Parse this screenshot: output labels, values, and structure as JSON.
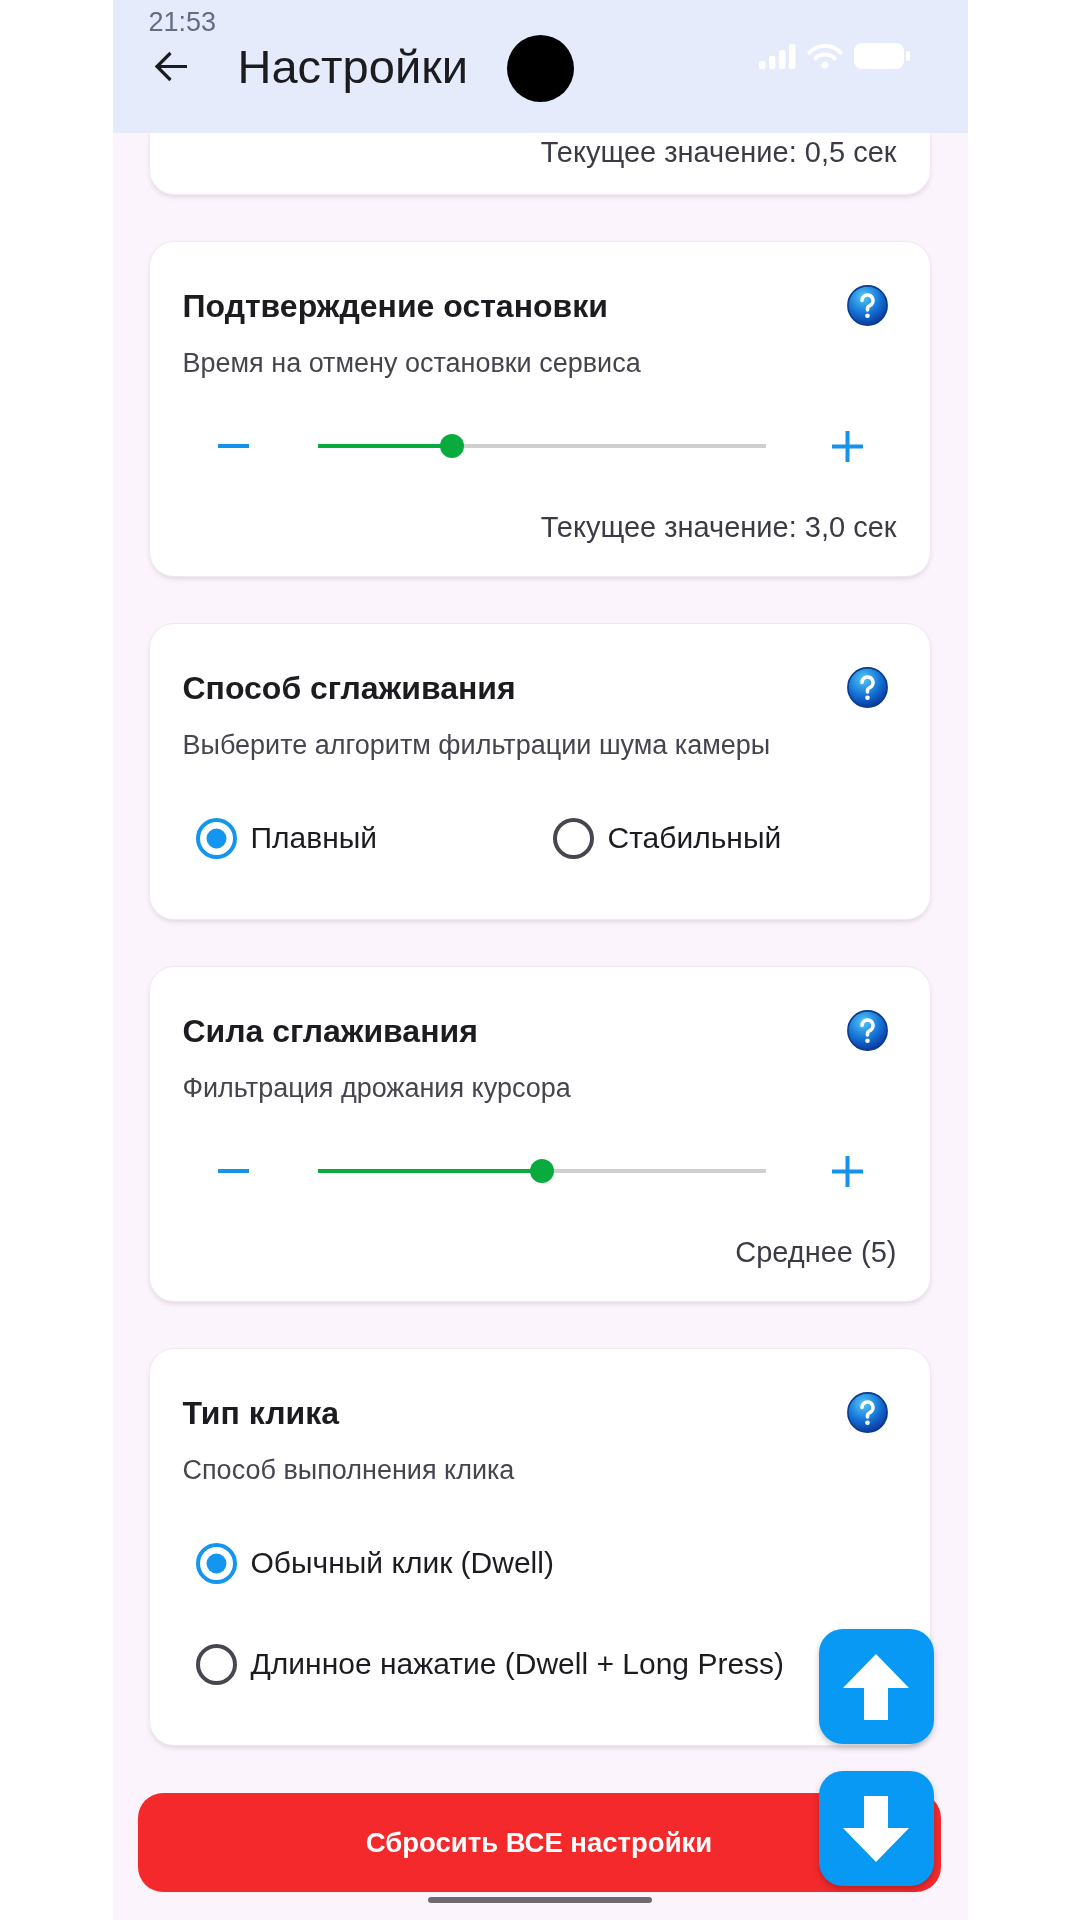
{
  "status_bar": {
    "time": "21:53"
  },
  "app_bar": {
    "title": "Настройки"
  },
  "cards": [
    {
      "kind": "slider",
      "value": "Текущее значение: 0,5 сек"
    },
    {
      "kind": "slider",
      "title": "Подтверждение остановки",
      "description": "Время на отмену остановки сервиса",
      "level": 0.3,
      "value": "Текущее значение: 3,0 сек"
    },
    {
      "kind": "radio_row",
      "title": "Способ сглаживания",
      "description": "Выберите алгоритм фильтрации шума камеры",
      "options": [
        {
          "label": "Плавный",
          "selected": true
        },
        {
          "label": "Стабильный",
          "selected": false
        }
      ]
    },
    {
      "kind": "slider",
      "title": "Сила сглаживания",
      "description": "Фильтрация дрожания курсора",
      "level": 0.5,
      "value": "Среднее (5)"
    },
    {
      "kind": "radio_list",
      "title": "Тип клика",
      "description": "Способ выполнения клика",
      "options": [
        {
          "label": "Обычный клик (Dwell)",
          "selected": true
        },
        {
          "label": "Длинное нажатие (Dwell + Long Press)",
          "selected": false
        }
      ]
    }
  ],
  "reset_button": {
    "label": "Сбросить ВСЕ настройки"
  }
}
